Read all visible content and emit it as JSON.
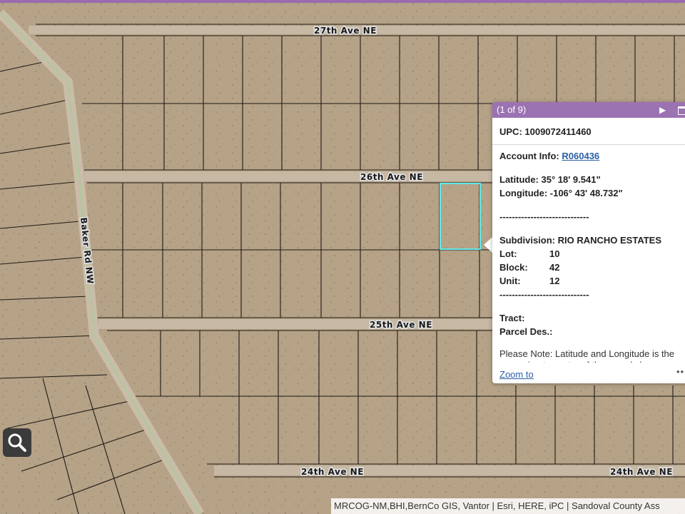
{
  "map": {
    "roads": {
      "ave27": "27th Ave NE",
      "ave26": "26th Ave NE",
      "ave25": "25th Ave NE",
      "ave24_left": "24th Ave NE",
      "ave24_right": "24th Ave NE",
      "baker": "Baker Rd NW"
    },
    "colors": {
      "terrain": "#b5a287",
      "road": "#c9bca9",
      "parcel_line": "#1e1a16",
      "selection": "#5fe8e8",
      "green_road": "#a9cc9a",
      "accent": "#9b72b2"
    },
    "attribution": "MRCOG-NM,BHI,BernCo GIS, Vantor | Esri, HERE, iPC | Sandoval County Ass"
  },
  "popup": {
    "counter": "(1 of 9)",
    "next_icon": "play-icon",
    "upc": "UPC: 1009072411460",
    "account_label": "Account Info: ",
    "account_value": "R060436",
    "latitude": "Latitude: 35° 18' 9.541\"",
    "longitude": "Longitude: -106° 43' 48.732\"",
    "divider": "-----------------------------",
    "subdivision": "Subdivision: RIO RANCHO ESTATES",
    "lot_label": "Lot:",
    "lot_value": "10",
    "block_label": "Block:",
    "block_value": "42",
    "unit_label": "Unit:",
    "unit_value": "12",
    "divider2": "-----------------------------",
    "tract": "Tract:",
    "parcel_des": "Parcel Des.:",
    "note": "Please Note: Latitude and Longitude is the approximate center of the parcel shown.",
    "zoom_link": "Zoom to",
    "more": "•••"
  }
}
